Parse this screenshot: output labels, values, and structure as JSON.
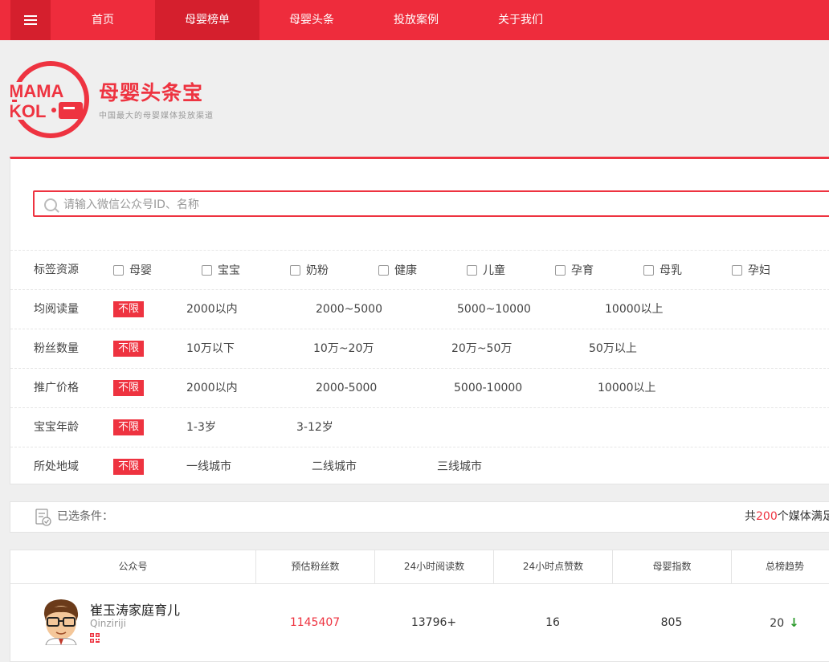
{
  "nav": {
    "items": [
      "首页",
      "母婴榜单",
      "母婴头条",
      "投放案例",
      "关于我们"
    ],
    "active_index": 1
  },
  "logo": {
    "mark_line1": "MAMA",
    "mark_line2": "KOL",
    "title": "母婴头条宝",
    "subtitle": "中国最大的母婴媒体投放渠道"
  },
  "search": {
    "placeholder": "请输入微信公众号ID、名称",
    "value": ""
  },
  "filters": {
    "tags": {
      "label": "标签资源",
      "options": [
        "母婴",
        "宝宝",
        "奶粉",
        "健康",
        "儿童",
        "孕育",
        "母乳",
        "孕妇"
      ]
    },
    "avg_reads": {
      "label": "均阅读量",
      "selected": "不限",
      "options": [
        "2000以内",
        "2000~5000",
        "5000~10000",
        "10000以上"
      ]
    },
    "fans": {
      "label": "粉丝数量",
      "selected": "不限",
      "options": [
        "10万以下",
        "10万~20万",
        "20万~50万",
        "50万以上"
      ]
    },
    "price": {
      "label": "推广价格",
      "selected": "不限",
      "options": [
        "2000以内",
        "2000-5000",
        "5000-10000",
        "10000以上"
      ]
    },
    "baby_age": {
      "label": "宝宝年龄",
      "selected": "不限",
      "options": [
        "1-3岁",
        "3-12岁"
      ]
    },
    "region": {
      "label": "所处地域",
      "selected": "不限",
      "options": [
        "一线城市",
        "二线城市",
        "三线城市"
      ]
    }
  },
  "selected_bar": {
    "label": "已选条件：",
    "count_prefix": "共",
    "count": "200",
    "count_suffix": "个媒体满足"
  },
  "table": {
    "columns": [
      "公众号",
      "预估粉丝数",
      "24小时阅读数",
      "24小时点赞数",
      "母婴指数",
      "总榜趋势"
    ],
    "rows": [
      {
        "name": "崔玉涛家庭育儿",
        "id": "Qinziriji",
        "fans": "1145407",
        "reads_24h": "13796+",
        "likes_24h": "16",
        "index": "805",
        "rank": "20",
        "trend": "down"
      }
    ]
  },
  "colors": {
    "brand_red": "#ee2c3c",
    "nav_active": "#d51f2d",
    "trend_down": "#2a9a2a"
  },
  "icons": [
    "menu-icon",
    "search-icon",
    "checkbox-icon",
    "filter-list-icon",
    "qr-code-icon",
    "arrow-down-icon"
  ]
}
